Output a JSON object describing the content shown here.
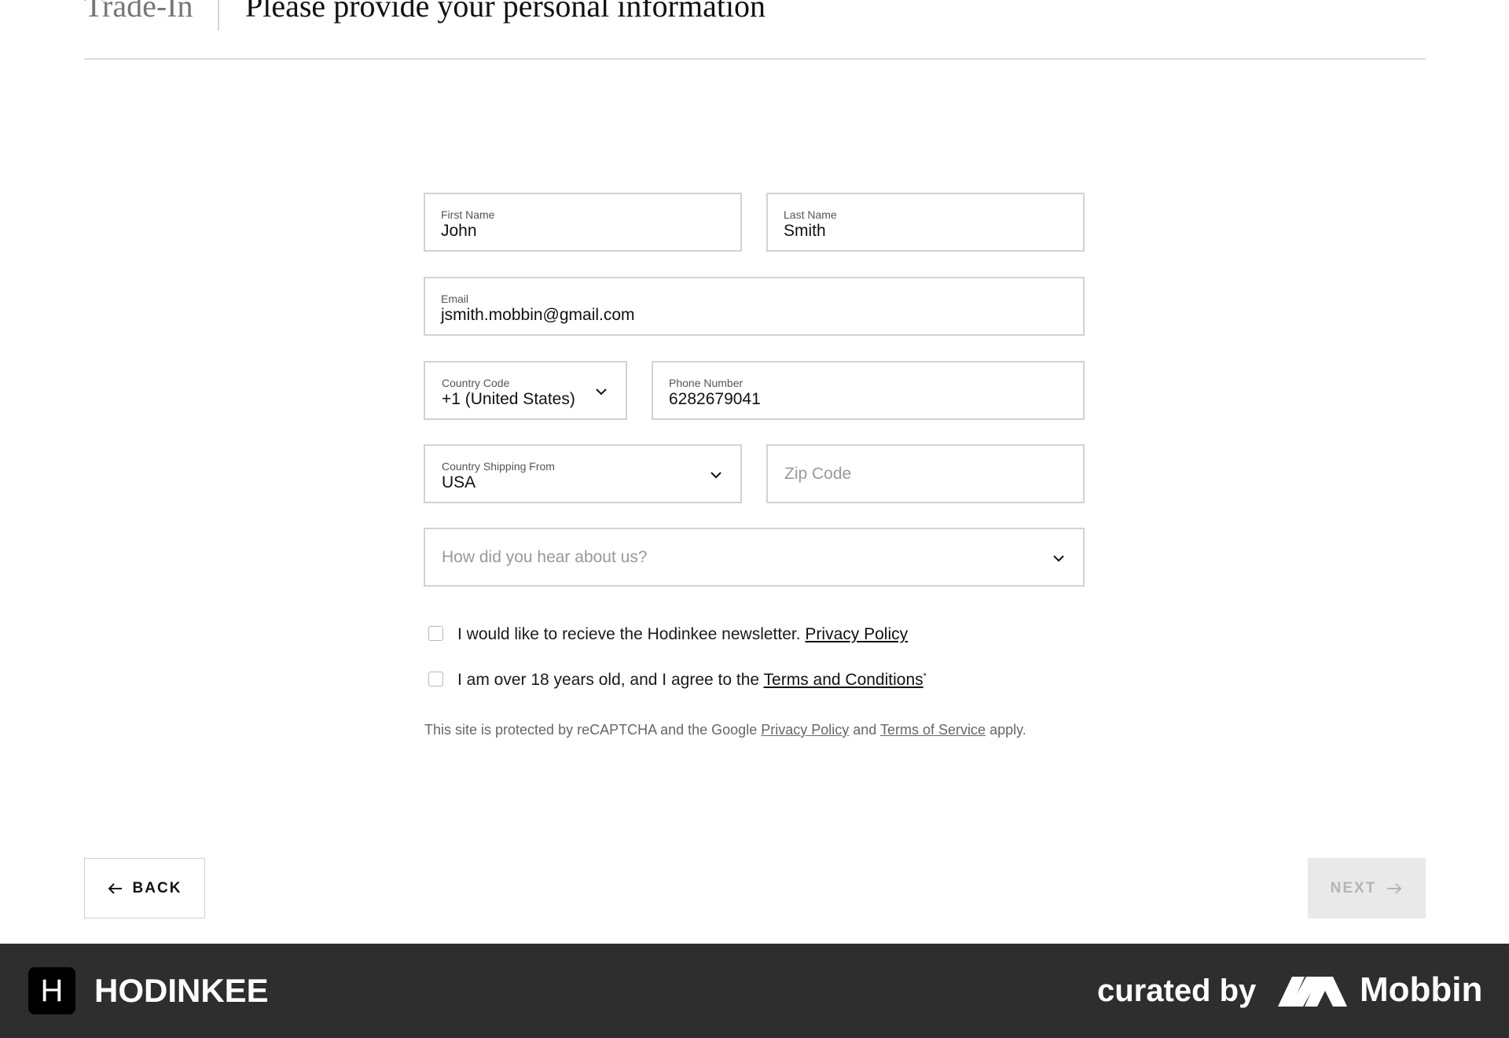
{
  "header": {
    "section": "Trade-In",
    "title": "Please provide your personal information"
  },
  "form": {
    "first_name": {
      "label": "First Name",
      "value": "John"
    },
    "last_name": {
      "label": "Last Name",
      "value": "Smith"
    },
    "email": {
      "label": "Email",
      "value": "jsmith.mobbin@gmail.com"
    },
    "country_code": {
      "label": "Country Code",
      "value": "+1 (United States)"
    },
    "phone": {
      "label": "Phone Number",
      "value": "6282679041"
    },
    "shipping_country": {
      "label": "Country Shipping From",
      "value": "USA"
    },
    "zip": {
      "placeholder": "Zip Code"
    },
    "referral": {
      "placeholder": "How did you hear about us?"
    }
  },
  "checkboxes": {
    "newsletter": {
      "text": "I would like to recieve the Hodinkee newsletter.",
      "link": "Privacy Policy",
      "checked": false
    },
    "terms": {
      "text": "I am over 18 years old, and I agree to the",
      "link": "Terms and Conditions",
      "mark": "*",
      "checked": false
    }
  },
  "legal": {
    "prefix": "This site is protected by reCAPTCHA and the Google",
    "privacy_link": "Privacy Policy",
    "and": "and",
    "terms_link": "Terms of Service",
    "suffix": "apply."
  },
  "buttons": {
    "back": "BACK",
    "next": "NEXT"
  },
  "footer": {
    "logo_letter": "H",
    "brand": "HODINKEE",
    "curated": "curated by",
    "mobbin": "Mobbin"
  },
  "icons": {
    "back": "arrow-left-icon",
    "next": "arrow-right-icon",
    "dropdown": "chevron-down-icon"
  },
  "colors": {
    "footer_bg": "#2e2e2e",
    "next_disabled_bg": "#e9e9e9",
    "border": "#d2d2d2"
  }
}
